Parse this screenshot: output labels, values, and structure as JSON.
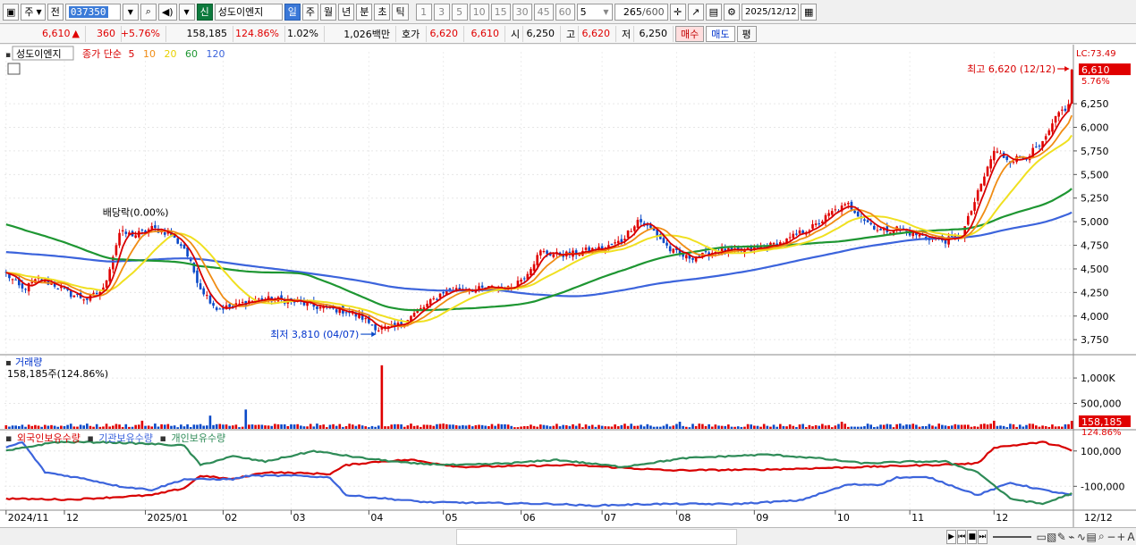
{
  "toolbar": {
    "market_label": "주",
    "prev_label": "전",
    "stock_code": "037350",
    "credit_badge": "신",
    "stock_name": "성도이엔지",
    "periods": [
      "일",
      "주",
      "월",
      "년",
      "분",
      "초",
      "틱"
    ],
    "active_period": "일",
    "intervals": [
      "1",
      "3",
      "5",
      "10",
      "15",
      "30",
      "45",
      "60"
    ],
    "interval_value": "5",
    "count_value": "265",
    "count_max": "/600",
    "date_value": "2025/12/12"
  },
  "quote": {
    "price": "6,610",
    "change_arrow": "▲",
    "change": "360",
    "change_rate": "+5.76%",
    "volume": "158,185",
    "volume_ratio": "124.86%",
    "turnover_rate": "1.02%",
    "amount": "1,026백만",
    "ask_label": "호가",
    "ask": "6,620",
    "bid": "6,610",
    "open_label": "시",
    "open": "6,250",
    "high_label": "고",
    "high": "6,620",
    "low_label": "저",
    "low": "6,250",
    "buy_label": "매수",
    "sell_label": "매도",
    "eval_label": "평"
  },
  "colors": {
    "up": "#e00000",
    "down": "#0a49c8",
    "ma5": "#d80000",
    "ma10": "#f08c14",
    "ma20": "#f0e020",
    "ma60": "#1e9632",
    "ma120": "#3c64dc",
    "foreign": "#d80000",
    "institution": "#3c64dc",
    "individual": "#2e8b57"
  },
  "chart_data": [
    {
      "type": "candlestick",
      "title": "성도이엔지",
      "legend": {
        "label": "종가 단순",
        "periods": [
          "5",
          "10",
          "20",
          "60",
          "120"
        ]
      },
      "x_ticks": [
        "2024/11",
        "12",
        "2025/01",
        "02",
        "03",
        "04",
        "05",
        "06",
        "07",
        "08",
        "09",
        "10",
        "11",
        "12"
      ],
      "right_axis_date": "12/12",
      "y_ticks": [
        3750,
        4000,
        4250,
        4500,
        4750,
        5000,
        5250,
        5500,
        5750,
        6000,
        6250
      ],
      "ylim": [
        3600,
        6800
      ],
      "last_price_label": "6,610",
      "last_pct_label": "5.76%",
      "top_label": "LC:73.49",
      "annotations": {
        "high": "최고 6,620 (12/12)",
        "low": "최저 3,810 (04/07)",
        "dividend": "배당락(0.00%)"
      },
      "anchors": [
        [
          0,
          4450
        ],
        [
          5,
          4280
        ],
        [
          10,
          4390
        ],
        [
          15,
          4330
        ],
        [
          20,
          4230
        ],
        [
          25,
          4180
        ],
        [
          30,
          4280
        ],
        [
          35,
          4880
        ],
        [
          40,
          4860
        ],
        [
          45,
          4930
        ],
        [
          50,
          4880
        ],
        [
          55,
          4720
        ],
        [
          60,
          4300
        ],
        [
          65,
          4080
        ],
        [
          70,
          4100
        ],
        [
          75,
          4160
        ],
        [
          80,
          4180
        ],
        [
          85,
          4170
        ],
        [
          90,
          4150
        ],
        [
          95,
          4100
        ],
        [
          100,
          4080
        ],
        [
          105,
          4050
        ],
        [
          110,
          3980
        ],
        [
          115,
          3860
        ],
        [
          120,
          3880
        ],
        [
          125,
          4000
        ],
        [
          130,
          4120
        ],
        [
          135,
          4260
        ],
        [
          140,
          4290
        ],
        [
          145,
          4280
        ],
        [
          150,
          4300
        ],
        [
          155,
          4290
        ],
        [
          160,
          4420
        ],
        [
          165,
          4680
        ],
        [
          170,
          4650
        ],
        [
          175,
          4660
        ],
        [
          180,
          4700
        ],
        [
          185,
          4720
        ],
        [
          190,
          4800
        ],
        [
          195,
          5020
        ],
        [
          200,
          4900
        ],
        [
          205,
          4700
        ],
        [
          210,
          4620
        ],
        [
          215,
          4640
        ],
        [
          220,
          4700
        ],
        [
          225,
          4680
        ],
        [
          230,
          4700
        ],
        [
          235,
          4740
        ],
        [
          240,
          4780
        ],
        [
          245,
          4880
        ],
        [
          250,
          4960
        ],
        [
          255,
          5100
        ],
        [
          260,
          5180
        ],
        [
          265,
          5020
        ],
        [
          270,
          4900
        ],
        [
          275,
          4930
        ],
        [
          280,
          4870
        ],
        [
          285,
          4830
        ],
        [
          290,
          4800
        ],
        [
          295,
          4850
        ],
        [
          300,
          5300
        ],
        [
          305,
          5750
        ],
        [
          310,
          5650
        ],
        [
          315,
          5700
        ],
        [
          320,
          5820
        ],
        [
          325,
          6150
        ],
        [
          329,
          6250
        ]
      ],
      "ma_seeds": {
        "ma60": 4980,
        "ma120": 4680
      },
      "last_candle": {
        "open": 6250,
        "high": 6620,
        "low": 6250,
        "close": 6610
      }
    },
    {
      "type": "bar",
      "title": "거래량",
      "subtitle": "158,185주(124.86%)",
      "y_ticks": [
        "1,000K",
        "500,000"
      ],
      "y_tick_values": [
        1000000,
        500000
      ],
      "ylim": [
        0,
        1300000
      ],
      "last_value_label": "158,185",
      "last_pct_label": "124.86%",
      "spikes": [
        {
          "i": 116,
          "value": 1250000
        },
        {
          "i": 74,
          "value": 380000
        },
        {
          "i": 63,
          "value": 260000
        },
        {
          "i": 42,
          "value": 160000
        },
        {
          "i": 305,
          "value": 160000
        },
        {
          "i": 208,
          "value": 140000
        },
        {
          "i": 258,
          "value": 140000
        }
      ],
      "base_volume": 80000,
      "last_volume": 158185
    },
    {
      "type": "line",
      "legend": [
        "외국인보유수량",
        "기관보유수량",
        "개인보유수량"
      ],
      "y_ticks": [
        "100,000",
        "-100,000"
      ],
      "y_tick_values": [
        100000,
        -100000
      ],
      "ylim": [
        -230000,
        200000
      ],
      "series": [
        {
          "name": "외국인보유수량",
          "color_key": "foreign",
          "anchors": [
            [
              0,
              -170000
            ],
            [
              20,
              -175000
            ],
            [
              45,
              -150000
            ],
            [
              55,
              -110000
            ],
            [
              60,
              -40000
            ],
            [
              70,
              -60000
            ],
            [
              80,
              -20000
            ],
            [
              100,
              -30000
            ],
            [
              105,
              20000
            ],
            [
              115,
              40000
            ],
            [
              125,
              50000
            ],
            [
              140,
              10000
            ],
            [
              175,
              20000
            ],
            [
              205,
              -10000
            ],
            [
              235,
              -5000
            ],
            [
              265,
              10000
            ],
            [
              285,
              20000
            ],
            [
              300,
              30000
            ],
            [
              305,
              120000
            ],
            [
              320,
              150000
            ],
            [
              325,
              130000
            ],
            [
              329,
              100000
            ]
          ]
        },
        {
          "name": "기관보유수량",
          "color_key": "institution",
          "anchors": [
            [
              0,
              120000
            ],
            [
              5,
              150000
            ],
            [
              12,
              -20000
            ],
            [
              25,
              -60000
            ],
            [
              35,
              -100000
            ],
            [
              45,
              -120000
            ],
            [
              55,
              -60000
            ],
            [
              70,
              -60000
            ],
            [
              75,
              -40000
            ],
            [
              90,
              -40000
            ],
            [
              100,
              -50000
            ],
            [
              105,
              -150000
            ],
            [
              130,
              -190000
            ],
            [
              170,
              -200000
            ],
            [
              180,
              -210000
            ],
            [
              200,
              -200000
            ],
            [
              225,
              -200000
            ],
            [
              245,
              -180000
            ],
            [
              260,
              -90000
            ],
            [
              270,
              -90000
            ],
            [
              275,
              -50000
            ],
            [
              285,
              -50000
            ],
            [
              300,
              -150000
            ],
            [
              310,
              -80000
            ],
            [
              320,
              -120000
            ],
            [
              329,
              -150000
            ]
          ]
        },
        {
          "name": "개인보유수량",
          "color_key": "individual",
          "anchors": [
            [
              0,
              100000
            ],
            [
              15,
              150000
            ],
            [
              30,
              150000
            ],
            [
              45,
              140000
            ],
            [
              55,
              130000
            ],
            [
              60,
              20000
            ],
            [
              70,
              70000
            ],
            [
              80,
              40000
            ],
            [
              95,
              100000
            ],
            [
              110,
              60000
            ],
            [
              125,
              30000
            ],
            [
              140,
              20000
            ],
            [
              155,
              30000
            ],
            [
              170,
              50000
            ],
            [
              190,
              10000
            ],
            [
              210,
              60000
            ],
            [
              235,
              80000
            ],
            [
              250,
              60000
            ],
            [
              265,
              30000
            ],
            [
              280,
              40000
            ],
            [
              290,
              40000
            ],
            [
              300,
              -20000
            ],
            [
              310,
              -170000
            ],
            [
              320,
              -200000
            ],
            [
              329,
              -140000
            ]
          ]
        }
      ]
    }
  ],
  "bottom": {
    "icons": [
      "first-icon",
      "prev-icon",
      "stop-icon",
      "next-icon"
    ]
  }
}
